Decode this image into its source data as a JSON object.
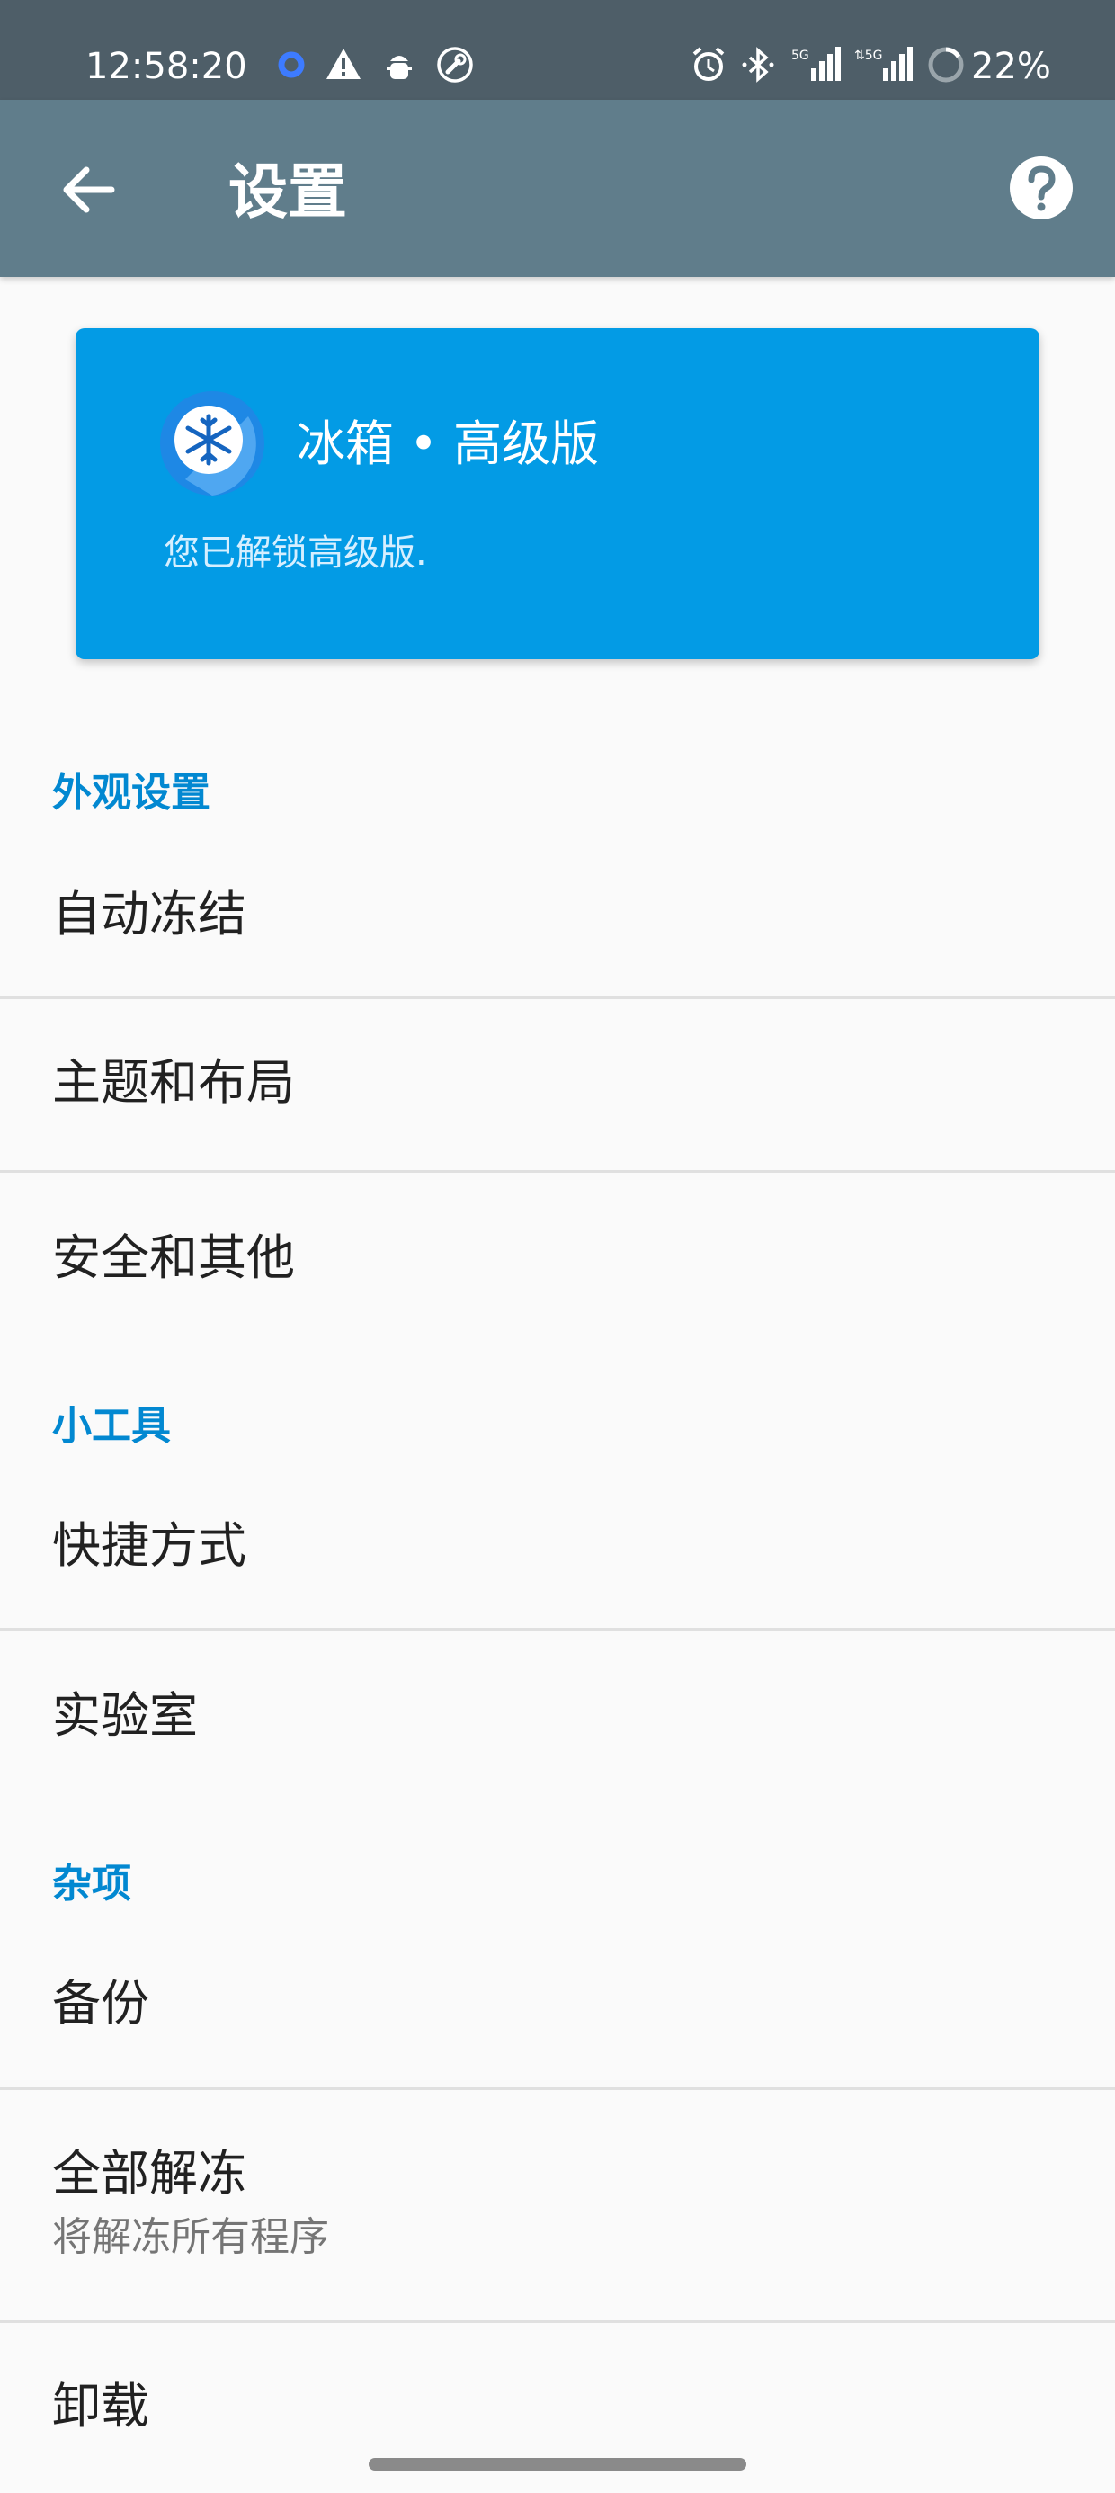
{
  "status_bar": {
    "time": "12:58:20",
    "battery": "22%",
    "icons": [
      "app-notification-icon",
      "warning-icon",
      "android-debug-icon",
      "wrench-icon",
      "alarm-icon",
      "bluetooth-icon",
      "signal-5g-icon",
      "signal-5g-icon",
      "battery-saver-icon"
    ]
  },
  "app_bar": {
    "title": "设置",
    "back_icon": "arrow-back-icon",
    "help_icon": "help-circle-icon"
  },
  "premium_card": {
    "title": "冰箱 • 高级版",
    "subtitle": "您已解锁高级版.",
    "logo": "ice-box-snowflake-logo",
    "color": "#039be5"
  },
  "sections": [
    {
      "header": "外观设置",
      "items": [
        {
          "title": "自动冻结"
        },
        {
          "title": "主题和布局"
        },
        {
          "title": "安全和其他"
        }
      ]
    },
    {
      "header": "小工具",
      "items": [
        {
          "title": "快捷方式"
        },
        {
          "title": "实验室"
        }
      ]
    },
    {
      "header": "杂项",
      "items": [
        {
          "title": "备份"
        },
        {
          "title": "全部解冻",
          "summary": "将解冻所有程序"
        },
        {
          "title": "卸载"
        }
      ]
    }
  ],
  "colors": {
    "status_bar": "#4e5e68",
    "app_bar": "#607d8b",
    "accent": "#0288d1",
    "background": "#fafafa"
  }
}
